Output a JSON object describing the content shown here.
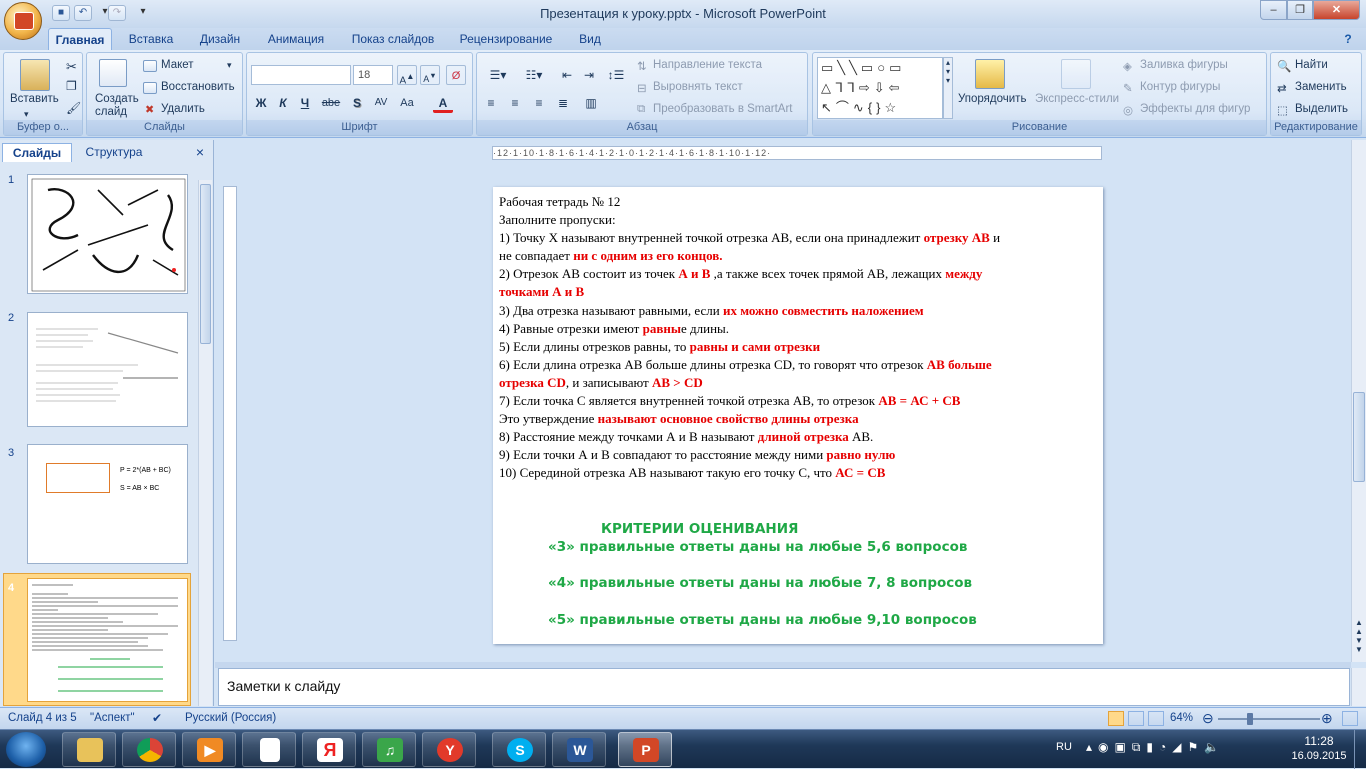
{
  "window": {
    "title": "Презентация к уроку.pptx - Microsoft PowerPoint"
  },
  "ribbon_tabs": [
    "Главная",
    "Вставка",
    "Дизайн",
    "Анимация",
    "Показ слайдов",
    "Рецензирование",
    "Вид"
  ],
  "groups": {
    "clipboard": {
      "label": "Буфер о...",
      "paste": "Вставить"
    },
    "slides": {
      "label": "Слайды",
      "new_slide": "Создать\nслайд",
      "layout": "Макет",
      "reset": "Восстановить",
      "delete": "Удалить"
    },
    "font": {
      "label": "Шрифт",
      "font_size": "18",
      "bold": "Ж",
      "italic": "К",
      "underline": "Ч",
      "strike": "abe",
      "shadow": "S"
    },
    "paragraph": {
      "label": "Абзац",
      "text_direction": "Направление текста",
      "align_text": "Выровнять текст",
      "smartart": "Преобразовать в SmartArt"
    },
    "drawing": {
      "label": "Рисование",
      "arrange": "Упорядочить",
      "quick_styles": "Экспресс-стили",
      "fill": "Заливка фигуры",
      "outline": "Контур фигуры",
      "effects": "Эффекты для фигур"
    },
    "editing": {
      "label": "Редактирование",
      "find": "Найти",
      "replace": "Заменить",
      "select": "Выделить"
    }
  },
  "left_panel": {
    "tab_slides": "Слайды",
    "tab_outline": "Структура",
    "close": "×",
    "slide_numbers": [
      "1",
      "2",
      "3",
      "4"
    ]
  },
  "thumb3": {
    "formula1": "P = 2*(AB + BC)",
    "formula2": "S = AB × BC"
  },
  "ruler": "·12·1·10·1·8·1·6·1·4·1·2·1·0·1·2·1·4·1·6·1·8·1·10·1·12·",
  "slide": {
    "lines": [
      {
        "parts": [
          {
            "t": "Рабочая тетрадь № 12",
            "red": false
          }
        ]
      },
      {
        "parts": [
          {
            "t": " ",
            "red": false
          }
        ]
      },
      {
        "parts": [
          {
            "t": "Заполните пропуски:",
            "red": false
          }
        ]
      },
      {
        "parts": [
          {
            "t": "1) Точку Х называют внутренней точкой отрезка АВ, если она принадлежит ",
            "red": false
          },
          {
            "t": "отрезку АВ",
            "red": true
          },
          {
            "t": " и",
            "red": false
          }
        ]
      },
      {
        "parts": [
          {
            "t": "не совпадает ",
            "red": false
          },
          {
            "t": "ни с одним из его концов.",
            "red": true
          }
        ]
      },
      {
        "parts": [
          {
            "t": "2) Отрезок АВ состоит из точек  ",
            "red": false
          },
          {
            "t": "А и В",
            "red": true
          },
          {
            "t": " ,а также всех точек прямой АВ, лежащих ",
            "red": false
          },
          {
            "t": "между",
            "red": true
          }
        ]
      },
      {
        "parts": [
          {
            "t": "точками А и В",
            "red": true
          }
        ]
      },
      {
        "parts": [
          {
            "t": "3) Два отрезка называют равными, если ",
            "red": false
          },
          {
            "t": "их можно совместить наложением",
            "red": true
          }
        ]
      },
      {
        "parts": [
          {
            "t": "4) Равные отрезки имеют  ",
            "red": false
          },
          {
            "t": "равны",
            "red": true
          },
          {
            "t": "е длины.",
            "red": false
          }
        ]
      },
      {
        "parts": [
          {
            "t": "5) Если длины отрезков равны, то ",
            "red": false
          },
          {
            "t": "равны и сами отрезки",
            "red": true
          }
        ]
      },
      {
        "parts": [
          {
            "t": "6) Если длина отрезка АВ больше длины отрезка CD, то говорят что отрезок ",
            "red": false
          },
          {
            "t": "АВ больше",
            "red": true
          }
        ]
      },
      {
        "parts": [
          {
            "t": "отрезка CD",
            "red": true
          },
          {
            "t": ", и записывают ",
            "red": false
          },
          {
            "t": "АВ > CD",
            "red": true
          }
        ]
      },
      {
        "parts": [
          {
            "t": "7) Если точка С является внутренней точкой отрезка АВ, то отрезок ",
            "red": false
          },
          {
            "t": "АВ = АС + СВ",
            "red": true
          }
        ]
      },
      {
        "parts": [
          {
            "t": "Это утверждение ",
            "red": false
          },
          {
            "t": "называют  основное свойство длины отрезка",
            "red": true
          }
        ]
      },
      {
        "parts": [
          {
            "t": "8) Расстояние между точками А и В называют  ",
            "red": false
          },
          {
            "t": "длиной отрезка",
            "red": true
          },
          {
            "t": " АВ.",
            "red": false
          }
        ]
      },
      {
        "parts": [
          {
            "t": " 9) Если точки А и В совпадают то расстояние между ними  ",
            "red": false
          },
          {
            "t": "равно нулю",
            "red": true
          }
        ]
      },
      {
        "parts": [
          {
            "t": " 10) Серединой отрезка АВ называют такую его точку С, что  ",
            "red": false
          },
          {
            "t": "АС = СВ",
            "red": true
          }
        ]
      }
    ],
    "criteria_title": "КРИТЕРИИ ОЦЕНИВАНИЯ",
    "crit3": "«3»  правильные ответы даны  на любые 5,6  вопросов",
    "crit4": "«4» правильные ответы даны  на любые 7, 8 вопросов",
    "crit5": "«5» правильные ответы даны  на любые 9,10 вопросов"
  },
  "notes": {
    "placeholder": "Заметки к слайду"
  },
  "status": {
    "slide": "Слайд 4 из 5",
    "theme": "\"Аспект\"",
    "language": "Русский (Россия)",
    "zoom": "64%"
  },
  "taskbar": {
    "lang": "RU",
    "time": "11:28",
    "date": "16.09.2015"
  }
}
